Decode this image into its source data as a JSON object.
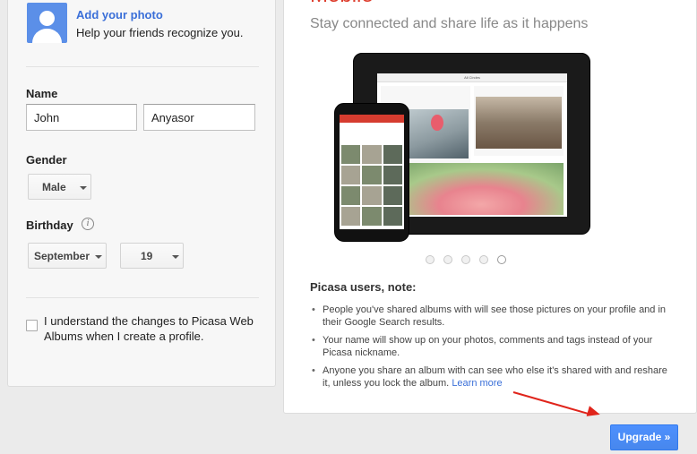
{
  "profile": {
    "add_photo_link": "Add your photo",
    "add_photo_help": "Help your friends recognize you.",
    "name_label": "Name",
    "first_name": "John",
    "last_name": "Anyasor",
    "gender_label": "Gender",
    "gender_value": "Male",
    "birthday_label": "Birthday",
    "birthday_month": "September",
    "birthday_day": "19",
    "info_icon_glyph": "i",
    "checkbox_label": "I understand the changes to Picasa Web Albums when I create a profile.",
    "checkbox_checked": false
  },
  "promo": {
    "title": "Mobile",
    "subtitle": "Stay connected and share life as it happens",
    "tablet_header": "All Circles",
    "carousel_count": 5,
    "carousel_active_index": 4,
    "note_title": "Picasa users, note:",
    "notes": [
      "People you've shared albums with will see those pictures on your profile and in their Google Search results.",
      "Your name will show up on your photos, comments and tags instead of your Picasa nickname.",
      "Anyone you share an album with can see who else it's shared with and reshare it, unless you lock the album."
    ],
    "learn_more": "Learn more"
  },
  "actions": {
    "upgrade_label": "Upgrade »"
  },
  "colors": {
    "accent_blue": "#4d90fe",
    "link_blue": "#3a6fd8",
    "promo_red": "#dd3b2b",
    "annotation_arrow": "#e0241b"
  }
}
